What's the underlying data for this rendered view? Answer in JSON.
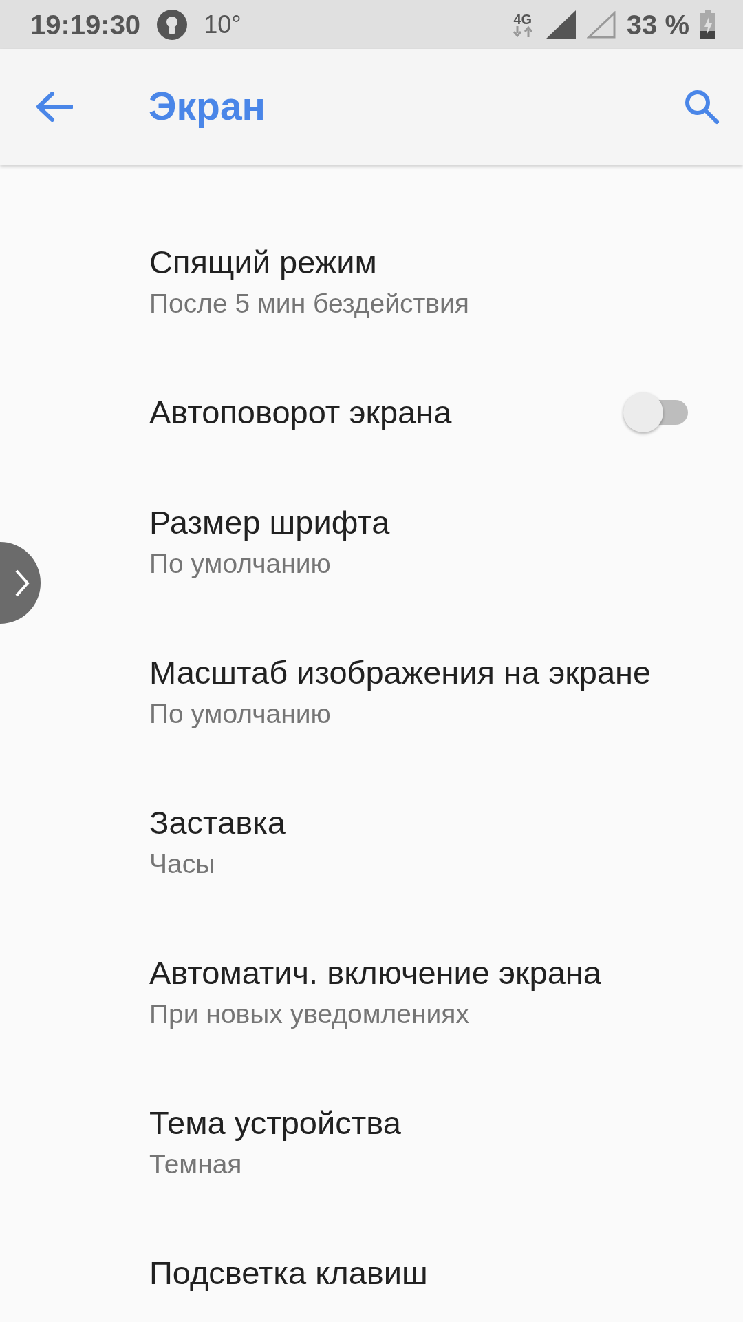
{
  "status_bar": {
    "time": "19:19:30",
    "temperature": "10°",
    "network": "4G",
    "battery": "33 %"
  },
  "app_bar": {
    "title": "Экран"
  },
  "settings": [
    {
      "kind": "text",
      "title": "Спящий режим",
      "summary": "После 5 мин бездействия"
    },
    {
      "kind": "toggle",
      "title": "Автоповорот экрана",
      "on": false
    },
    {
      "kind": "text",
      "title": "Размер шрифта",
      "summary": "По умолчанию"
    },
    {
      "kind": "text",
      "title": "Масштаб изображения на экране",
      "summary": "По умолчанию"
    },
    {
      "kind": "text",
      "title": "Заставка",
      "summary": "Часы"
    },
    {
      "kind": "text",
      "title": "Автоматич. включение экрана",
      "summary": "При новых уведомлениях"
    },
    {
      "kind": "text",
      "title": "Тема устройства",
      "summary": "Темная"
    },
    {
      "kind": "text",
      "title": "Подсветка клавиш"
    }
  ]
}
